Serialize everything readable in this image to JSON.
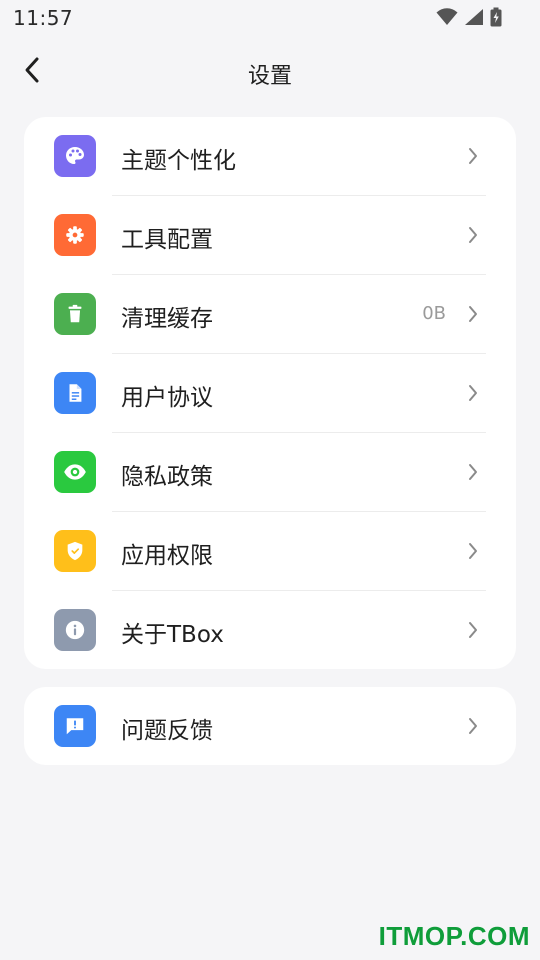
{
  "status_bar": {
    "time": "11:57",
    "icons": [
      "wifi-icon",
      "cell-signal-icon",
      "battery-charging-icon"
    ]
  },
  "header": {
    "back_icon": "chevron-left-icon",
    "title": "设置"
  },
  "settings": {
    "items": [
      {
        "label": "主题个性化",
        "icon": "palette-icon",
        "color": "#7b6cf0",
        "value": ""
      },
      {
        "label": "工具配置",
        "icon": "gear-icon",
        "color": "#ff6a35",
        "value": ""
      },
      {
        "label": "清理缓存",
        "icon": "trash-icon",
        "color": "#4caf50",
        "value": "0B"
      },
      {
        "label": "用户协议",
        "icon": "document-icon",
        "color": "#3d86f5",
        "value": ""
      },
      {
        "label": "隐私政策",
        "icon": "eye-icon",
        "color": "#2ac93f",
        "value": ""
      },
      {
        "label": "应用权限",
        "icon": "shield-check-icon",
        "color": "#ffbf1a",
        "value": ""
      },
      {
        "label": "关于TBox",
        "icon": "info-icon",
        "color": "#8e9aae",
        "value": ""
      }
    ]
  },
  "feedback": {
    "label": "问题反馈",
    "icon": "feedback-icon",
    "color": "#3d86f5"
  },
  "watermark": "ITMOP.COM"
}
